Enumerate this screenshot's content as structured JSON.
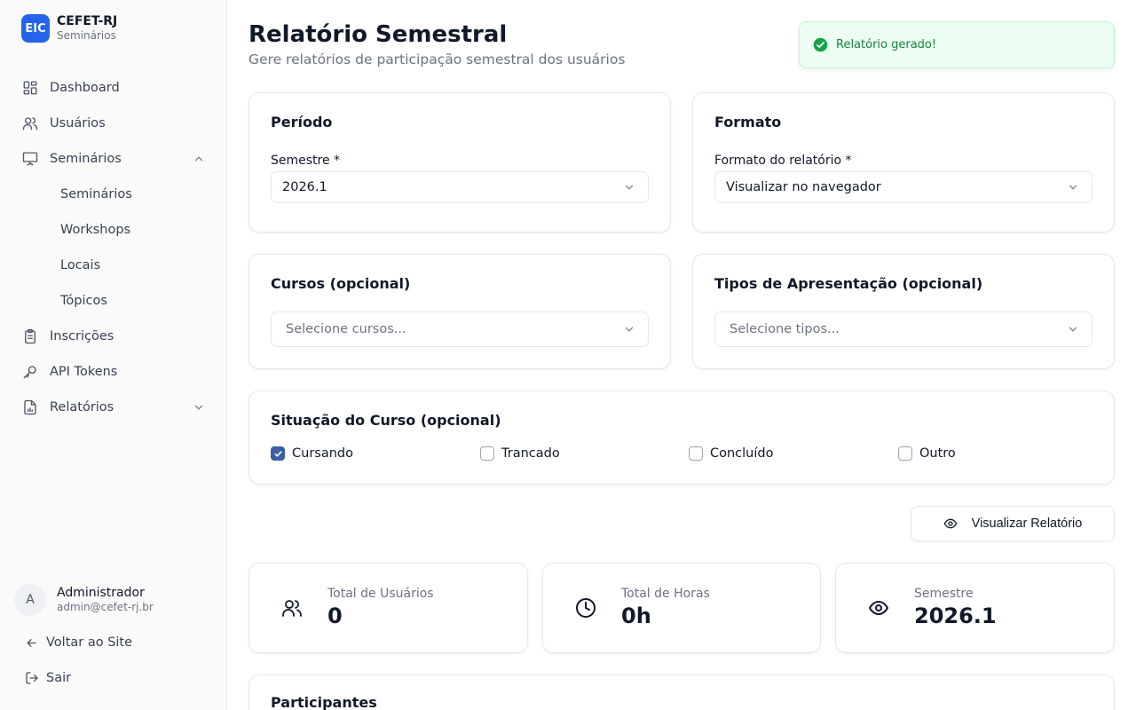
{
  "brand": {
    "logo": "EIC",
    "name": "CEFET-RJ",
    "subtitle": "Seminários"
  },
  "sidebar": {
    "items": [
      {
        "label": "Dashboard",
        "icon": "dashboard-icon"
      },
      {
        "label": "Usuários",
        "icon": "users-icon"
      },
      {
        "label": "Seminários",
        "icon": "presentation-icon",
        "expanded": true
      },
      {
        "label": "Inscrições",
        "icon": "clipboard-icon"
      },
      {
        "label": "API Tokens",
        "icon": "key-icon"
      },
      {
        "label": "Relatórios",
        "icon": "report-icon",
        "expanded": false
      }
    ],
    "sub_items": [
      "Seminários",
      "Workshops",
      "Locais",
      "Tópicos"
    ]
  },
  "user": {
    "initial": "A",
    "name": "Administrador",
    "email": "admin@cefet-rj.br"
  },
  "footer": {
    "back_label": "Voltar ao Site",
    "logout_label": "Sair"
  },
  "header": {
    "title": "Relatório Semestral",
    "subtitle": "Gere relatórios de participação semestral dos usuários"
  },
  "toast": {
    "message": "Relatório gerado!",
    "accent": "#15803d"
  },
  "period_card": {
    "title": "Período",
    "label": "Semestre *",
    "value": "2026.1"
  },
  "format_card": {
    "title": "Formato",
    "label": "Formato do relatório *",
    "value": "Visualizar no navegador"
  },
  "courses_card": {
    "title": "Cursos (opcional)",
    "placeholder": "Selecione cursos..."
  },
  "types_card": {
    "title": "Tipos de Apresentação (opcional)",
    "placeholder": "Selecione tipos..."
  },
  "status_card": {
    "title": "Situação do Curso (opcional)",
    "options": [
      {
        "label": "Cursando",
        "checked": true
      },
      {
        "label": "Trancado",
        "checked": false
      },
      {
        "label": "Concluído",
        "checked": false
      },
      {
        "label": "Outro",
        "checked": false
      }
    ]
  },
  "preview_button": {
    "label": "Visualizar Relatório"
  },
  "stats": [
    {
      "label": "Total de Usuários",
      "value": "0",
      "icon": "users-icon"
    },
    {
      "label": "Total de Horas",
      "value": "0h",
      "icon": "clock-icon"
    },
    {
      "label": "Semestre",
      "value": "2026.1",
      "icon": "eye-icon"
    }
  ],
  "participants": {
    "title": "Participantes"
  },
  "colors": {
    "primary": "#2563eb",
    "checkbox": "#3b5fa6",
    "toast_bg": "#ecfdf3"
  }
}
